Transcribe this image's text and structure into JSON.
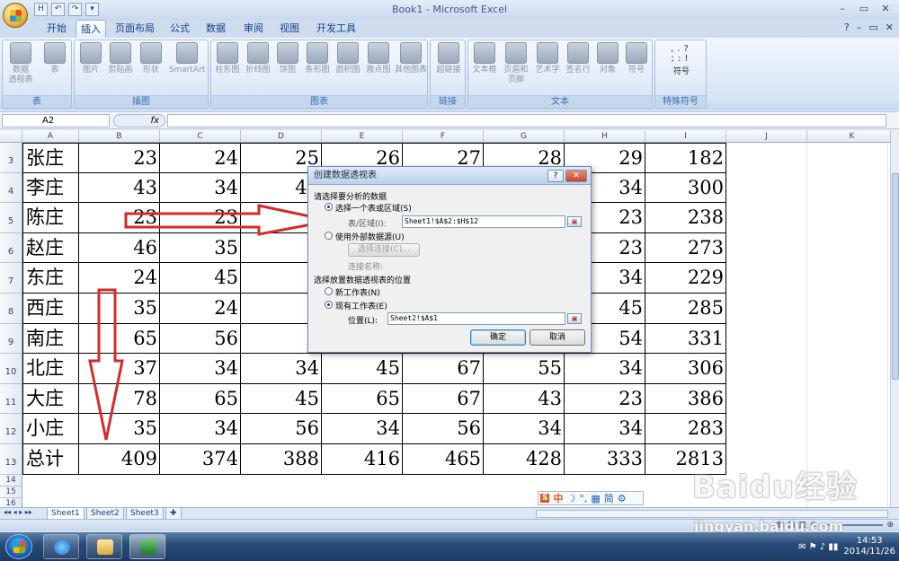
{
  "window": {
    "title": "Book1 - Microsoft Excel"
  },
  "qat": {
    "items": [
      "H",
      "↶",
      "↷",
      "▾"
    ]
  },
  "tabs": [
    "开始",
    "插入",
    "页面布局",
    "公式",
    "数据",
    "审阅",
    "视图",
    "开发工具"
  ],
  "active_tab": "插入",
  "ribbon": {
    "groups": [
      {
        "label": "表",
        "buttons": [
          "数据\n透视表",
          "表"
        ]
      },
      {
        "label": "插图",
        "buttons": [
          "图片",
          "剪贴画",
          "形状",
          "SmartArt"
        ]
      },
      {
        "label": "图表",
        "buttons": [
          "柱形图",
          "折线图",
          "饼图",
          "条形图",
          "面积图",
          "散点图",
          "其他图表"
        ]
      },
      {
        "label": "链接",
        "buttons": [
          "超链接"
        ]
      },
      {
        "label": "文本",
        "buttons": [
          "文本框",
          "页眉和\n页脚",
          "艺术字",
          "签名行",
          "对象",
          "符号"
        ]
      },
      {
        "label": "特殊符号",
        "buttons": [
          "符号"
        ]
      }
    ]
  },
  "formula_bar": {
    "name_box": "A2",
    "fx": "fx",
    "formula": ""
  },
  "columns": [
    "A",
    "B",
    "C",
    "D",
    "E",
    "F",
    "G",
    "H",
    "I",
    "J",
    "K"
  ],
  "rows": [
    {
      "num": "3",
      "name": "张庄",
      "values": [
        "23",
        "24",
        "25",
        "26",
        "27",
        "28",
        "29",
        "182"
      ]
    },
    {
      "num": "4",
      "name": "李庄",
      "values": [
        "43",
        "34",
        "45",
        "",
        "",
        "",
        "34",
        "300"
      ]
    },
    {
      "num": "5",
      "name": "陈庄",
      "values": [
        "23",
        "23",
        "3",
        "",
        "",
        "",
        "23",
        "238"
      ]
    },
    {
      "num": "6",
      "name": "赵庄",
      "values": [
        "46",
        "35",
        "4",
        "",
        "",
        "",
        "23",
        "273"
      ]
    },
    {
      "num": "7",
      "name": "东庄",
      "values": [
        "24",
        "45",
        "3",
        "",
        "",
        "",
        "34",
        "229"
      ]
    },
    {
      "num": "8",
      "name": "西庄",
      "values": [
        "35",
        "24",
        "4",
        "",
        "",
        "",
        "45",
        "285"
      ]
    },
    {
      "num": "9",
      "name": "南庄",
      "values": [
        "65",
        "56",
        "2",
        "",
        "",
        "",
        "54",
        "331"
      ]
    },
    {
      "num": "10",
      "name": "北庄",
      "values": [
        "37",
        "34",
        "34",
        "45",
        "67",
        "55",
        "34",
        "306"
      ]
    },
    {
      "num": "11",
      "name": "大庄",
      "values": [
        "78",
        "65",
        "45",
        "65",
        "67",
        "43",
        "23",
        "386"
      ]
    },
    {
      "num": "12",
      "name": "小庄",
      "values": [
        "35",
        "34",
        "56",
        "34",
        "56",
        "34",
        "34",
        "283"
      ]
    },
    {
      "num": "13",
      "name": "总计",
      "values": [
        "409",
        "374",
        "388",
        "416",
        "465",
        "428",
        "333",
        "2813"
      ]
    }
  ],
  "extra_rows": [
    "14",
    "15",
    "16"
  ],
  "sheets": [
    "Sheet1",
    "Sheet2",
    "Sheet3"
  ],
  "dialog": {
    "title": "创建数据透视表",
    "section1": "请选择要分析的数据",
    "opt_table": "选择一个表或区域(S)",
    "table_label": "表/区域(I):",
    "table_value": "Sheet1!$A$2:$H$12",
    "opt_external": "使用外部数据源(U)",
    "choose_conn": "选择连接(C)...",
    "conn_name": "连接名称:",
    "section2": "选择放置数据透视表的位置",
    "opt_new": "新工作表(N)",
    "opt_existing": "现有工作表(E)",
    "location_label": "位置(L):",
    "location_value": "Sheet2!$A$1",
    "ok": "确定",
    "cancel": "取消",
    "help": "?",
    "close": "✕"
  },
  "ime": {
    "items": [
      "中",
      "☽",
      "°,",
      "▦",
      "简",
      "⚙"
    ]
  },
  "watermark": {
    "big": "Baidu经验",
    "small": "jingyan.baidu.com"
  },
  "taskbar": {
    "time": "14:53",
    "date": "2014/11/26"
  }
}
